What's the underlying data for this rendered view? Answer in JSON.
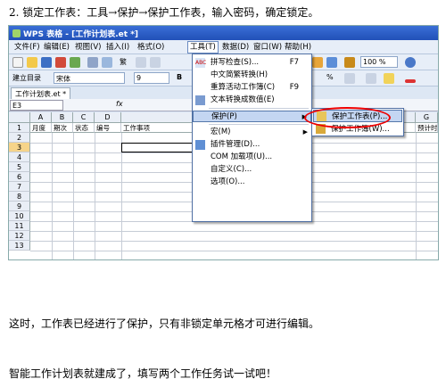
{
  "step_text": "2.    锁定工作表：工具→保护→保护工作表，输入密码，确定锁定。",
  "window": {
    "title": "WPS 表格 - [工作计划表.et *]"
  },
  "menubar": [
    "文件(F)",
    "编辑(E)",
    "视图(V)",
    "插入(I)",
    "格式(O)",
    "工具(T)",
    "数据(D)",
    "窗口(W)",
    "帮助(H)"
  ],
  "toolbar": {
    "zoom": "100 %",
    "quick_dir": "建立目录",
    "font": "宋体",
    "font_size": "9",
    "cell_value": "繁"
  },
  "doc_tab": "工作计划表.et *",
  "name_box": "E3",
  "fx": "fx",
  "columns": [
    "A",
    "B",
    "C",
    "D",
    "G"
  ],
  "headers": [
    "月度",
    "期次",
    "状态",
    "编号",
    "工作事项",
    "预计时间"
  ],
  "rows": [
    "1",
    "2",
    "3",
    "4",
    "5",
    "6",
    "7",
    "8",
    "9",
    "10",
    "11",
    "12",
    "13"
  ],
  "tools_menu": [
    {
      "label": "拼写检查(S)...",
      "shortcut": "F7"
    },
    {
      "label": "中文简繁转换(H)"
    },
    {
      "label": "重算活动工作簿(C)",
      "shortcut": "F9"
    },
    {
      "label": "文本转换成数值(E)"
    },
    {
      "label": "保护(P)"
    },
    {
      "label": "宏(M)"
    },
    {
      "label": "插件管理(D)..."
    },
    {
      "label": "COM 加载项(U)..."
    },
    {
      "label": "自定义(C)..."
    },
    {
      "label": "选项(O)..."
    }
  ],
  "protect_submenu": [
    "保护工作表(P)...",
    "保护工作簿(W)..."
  ],
  "para1": "这时，工作表已经进行了保护，只有非锁定单元格才可进行编辑。",
  "para2": "智能工作计划表就建成了，填写两个工作任务试一试吧！"
}
